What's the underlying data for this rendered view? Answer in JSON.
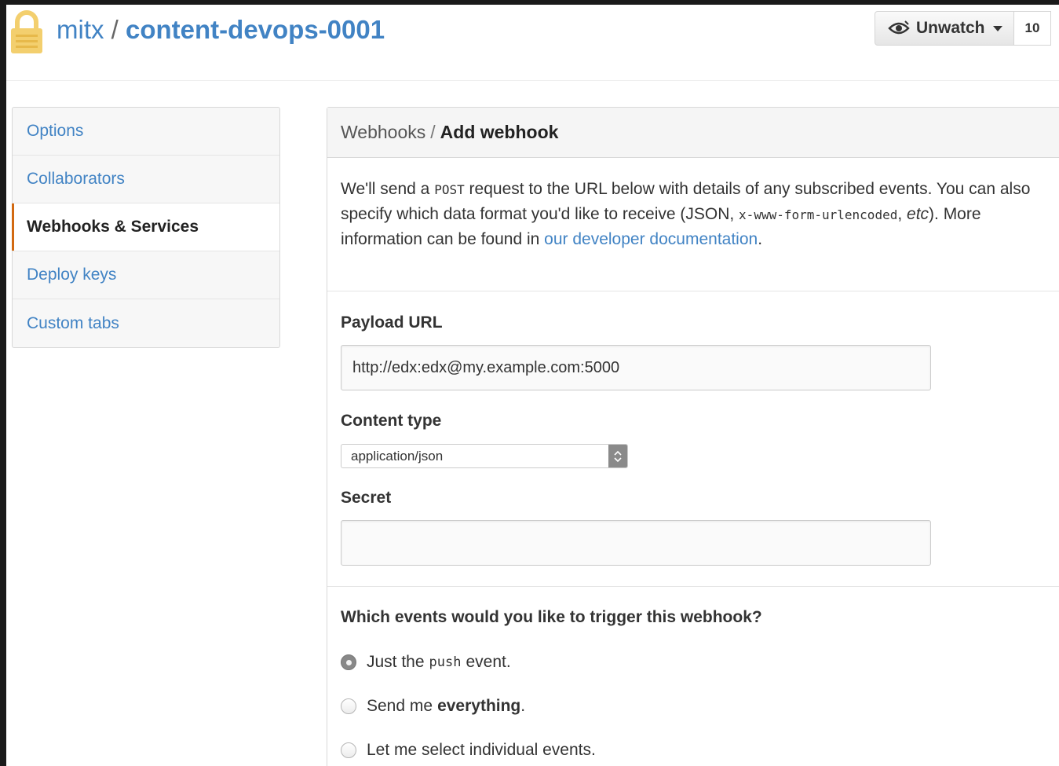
{
  "colors": {
    "link": "#4183c4",
    "selected_marker": "#d26911",
    "lock": "#f3cf6e"
  },
  "repo": {
    "owner": "mitx",
    "separator": "/",
    "name": "content-devops-0001",
    "icon": "lock-icon"
  },
  "watch": {
    "label": "Unwatch",
    "count": "10",
    "icon": "eye-icon"
  },
  "sidebar": {
    "items": [
      {
        "label": "Options",
        "selected": false
      },
      {
        "label": "Collaborators",
        "selected": false
      },
      {
        "label": "Webhooks & Services",
        "selected": true
      },
      {
        "label": "Deploy keys",
        "selected": false
      },
      {
        "label": "Custom tabs",
        "selected": false
      }
    ]
  },
  "breadcrumb": {
    "parent": "Webhooks",
    "separator": "/",
    "current": "Add webhook"
  },
  "intro": {
    "part1": "We'll send a ",
    "post": "POST",
    "part2": " request to the URL below with details of any subscribed events. You can also specify which data format you'd like to receive (JSON, ",
    "urlencoded": "x-www-form-urlencoded",
    "part3": ", ",
    "etc": "etc",
    "part4": "). More information can be found in ",
    "link": "our developer documentation",
    "part5": "."
  },
  "form": {
    "payload_label": "Payload URL",
    "payload_value": "http://edx:edx@my.example.com:5000",
    "content_type_label": "Content type",
    "content_type_value": "application/json",
    "secret_label": "Secret",
    "secret_value": ""
  },
  "events": {
    "title": "Which events would you like to trigger this webhook?",
    "options": [
      {
        "before": "Just the",
        "code": "push",
        "after": "event.",
        "checked": true
      },
      {
        "before": "Send me",
        "bold": "everything",
        "after": ".",
        "checked": false
      },
      {
        "before": "Let me select individual events.",
        "checked": false
      }
    ]
  }
}
